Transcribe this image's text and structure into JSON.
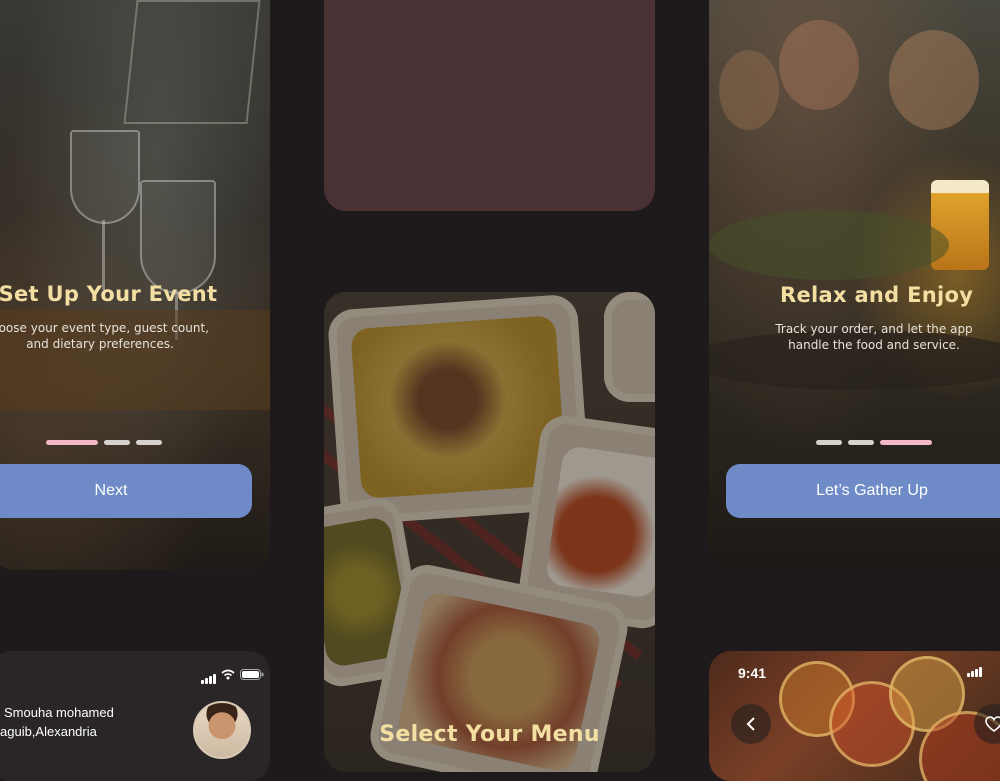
{
  "onboarding_left": {
    "title": "Set Up Your Event",
    "description": "hoose your event type, guest count, and dietary preferences.",
    "button_label": "Next",
    "page_index": 1,
    "page_count": 3
  },
  "onboarding_menu": {
    "title": "Select Your Menu"
  },
  "onboarding_right": {
    "title": "Relax and Enjoy",
    "description": "Track your order, and let the app handle the food and service.",
    "button_label": "Let’s Gather Up",
    "page_index": 3,
    "page_count": 3
  },
  "profile_card": {
    "address_line1": "Smouha mohamed",
    "address_line2": "aguib,Alexandria",
    "status_icons": [
      "signal-icon",
      "wifi-icon",
      "battery-icon"
    ]
  },
  "recipe_card": {
    "status_time": "9:41",
    "back_icon": "chevron-left-icon",
    "favorite_icon": "heart-icon"
  },
  "colors": {
    "background": "#1e1a1b",
    "accent_button": "#6e8ac7",
    "title_gold": "#f4dfa3",
    "active_dot": "#f2b8c8",
    "placeholder_card": "#4a3133"
  }
}
